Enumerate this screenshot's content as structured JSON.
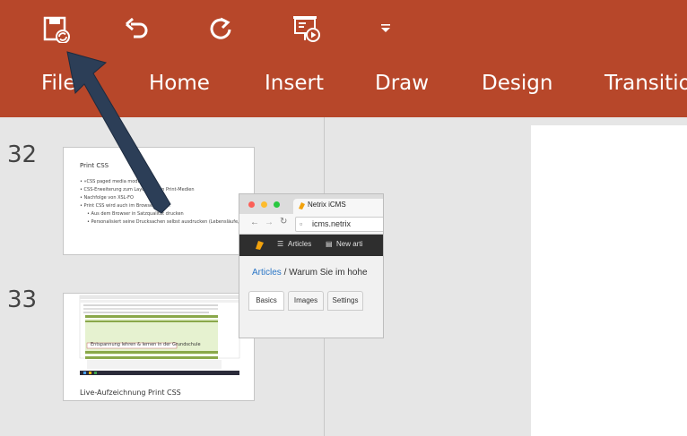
{
  "quick_access": {
    "save_icon": "save-sync-icon",
    "undo_icon": "undo-icon",
    "redo_icon": "redo-icon",
    "present_icon": "present-from-start-icon",
    "customize_icon": "caret-down-icon"
  },
  "ribbon": {
    "color": "#b7472a",
    "tabs": [
      "File",
      "Home",
      "Insert",
      "Draw",
      "Design",
      "Transitions"
    ]
  },
  "thumbnails": [
    {
      "number": "32",
      "title": "Print CSS",
      "bullets": [
        "• «CSS paged media module»",
        "• CSS-Erweiterung zum Layouten von Print-Medien",
        "• Nachfolge von XSL-FO",
        "• Print CSS wird auch im Browser lasst..."
      ],
      "sub_bullets": [
        "• Aus dem Browser in Satzqualität drucken",
        "• Personalisiert seine Drucksachen selbst ausdrucken (Lebensläufe, Rezeptkarten, Kochbuch...)"
      ]
    },
    {
      "number": "33",
      "mini_heading": "Entspannung lehren & lernen in der Grundschule",
      "caption": "Live-Aufzeichnung Print CSS"
    }
  ],
  "browser": {
    "tab_title": "Netrix iCMS",
    "url": "icms.netrix",
    "nav_articles": "Articles",
    "nav_new": "New arti",
    "breadcrumb_link": "Articles",
    "breadcrumb_rest": " / Warum Sie im hohe",
    "subtabs": [
      "Basics",
      "Images",
      "Settings"
    ]
  },
  "cursor": "arrow-pointer-icon"
}
